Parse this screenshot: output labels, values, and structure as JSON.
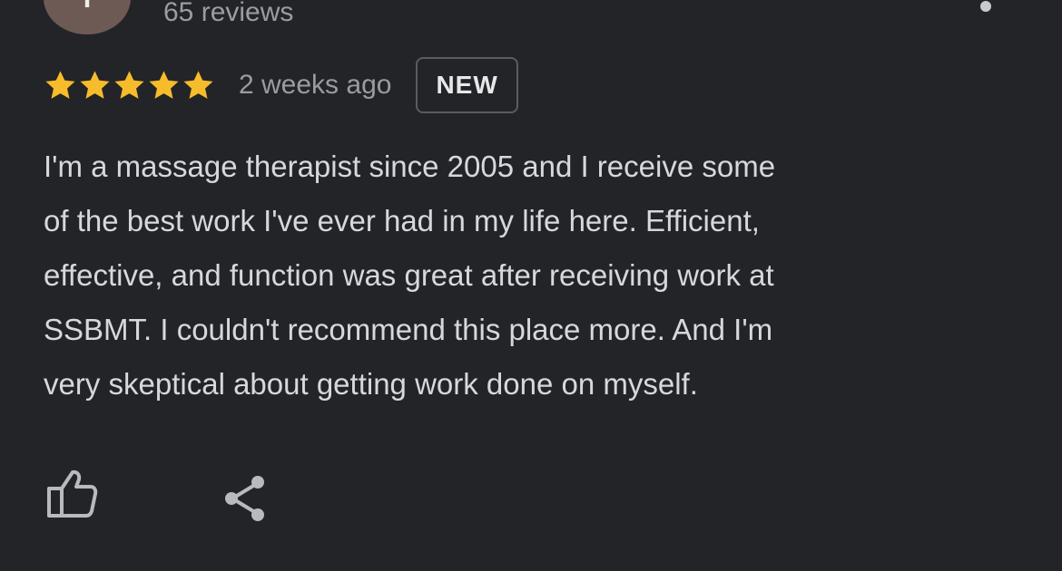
{
  "reviewer": {
    "avatar_initial": "T",
    "avatar_color": "#6e5a55",
    "reviews_count": "65 reviews"
  },
  "menu": {
    "icon": "more-vert-icon"
  },
  "review": {
    "rating": 5,
    "max_rating": 5,
    "star_color": "#f6bc2b",
    "time_ago": "2 weeks ago",
    "badge": "NEW",
    "text": "I'm a massage therapist since 2005 and I receive some\nof the best work I've ever had in my life here. Efficient,\neffective, and function was great after receiving work at\nSSBMT. I couldn't recommend this place more. And I'm\nvery skeptical about getting work done on myself."
  },
  "actions": {
    "like_icon": "thumbs-up-icon",
    "share_icon": "share-icon"
  }
}
